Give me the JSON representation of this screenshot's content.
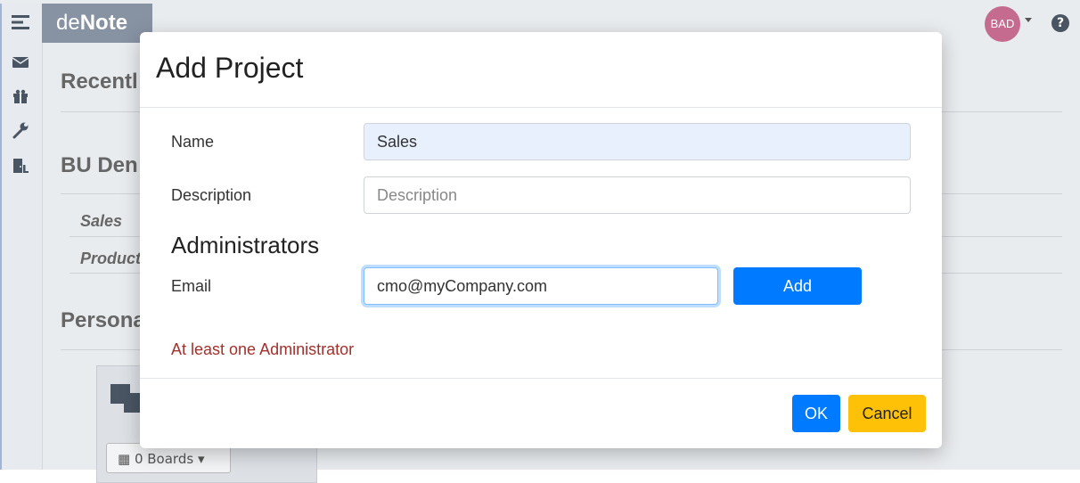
{
  "app": {
    "brand_prefix": "de",
    "brand_suffix": "Note",
    "avatar_initials": "BAD",
    "help_glyph": "?"
  },
  "sidebar": {
    "items": [
      {
        "icon": "menu-icon"
      },
      {
        "icon": "mail-icon"
      },
      {
        "icon": "gift-icon"
      },
      {
        "icon": "wrench-icon"
      },
      {
        "icon": "door-exit-icon"
      }
    ]
  },
  "background": {
    "recent_title": "Recentl",
    "bu_title": "BU Den",
    "projects": [
      "Sales",
      "Product"
    ],
    "personal_title": "Persona",
    "boards_button": "0 Boards"
  },
  "modal": {
    "title": "Add Project",
    "name_label": "Name",
    "name_value": "Sales",
    "description_label": "Description",
    "description_placeholder": "Description",
    "administrators_heading": "Administrators",
    "email_label": "Email",
    "email_value": "cmo@myCompany.com",
    "add_button": "Add",
    "error_message": "At least one Administrator",
    "ok_button": "OK",
    "cancel_button": "Cancel"
  },
  "colors": {
    "primary": "#007bff",
    "warning": "#ffc107",
    "error": "#a4302a",
    "avatar": "#c46b8f",
    "brand_bg": "#8792a3"
  }
}
